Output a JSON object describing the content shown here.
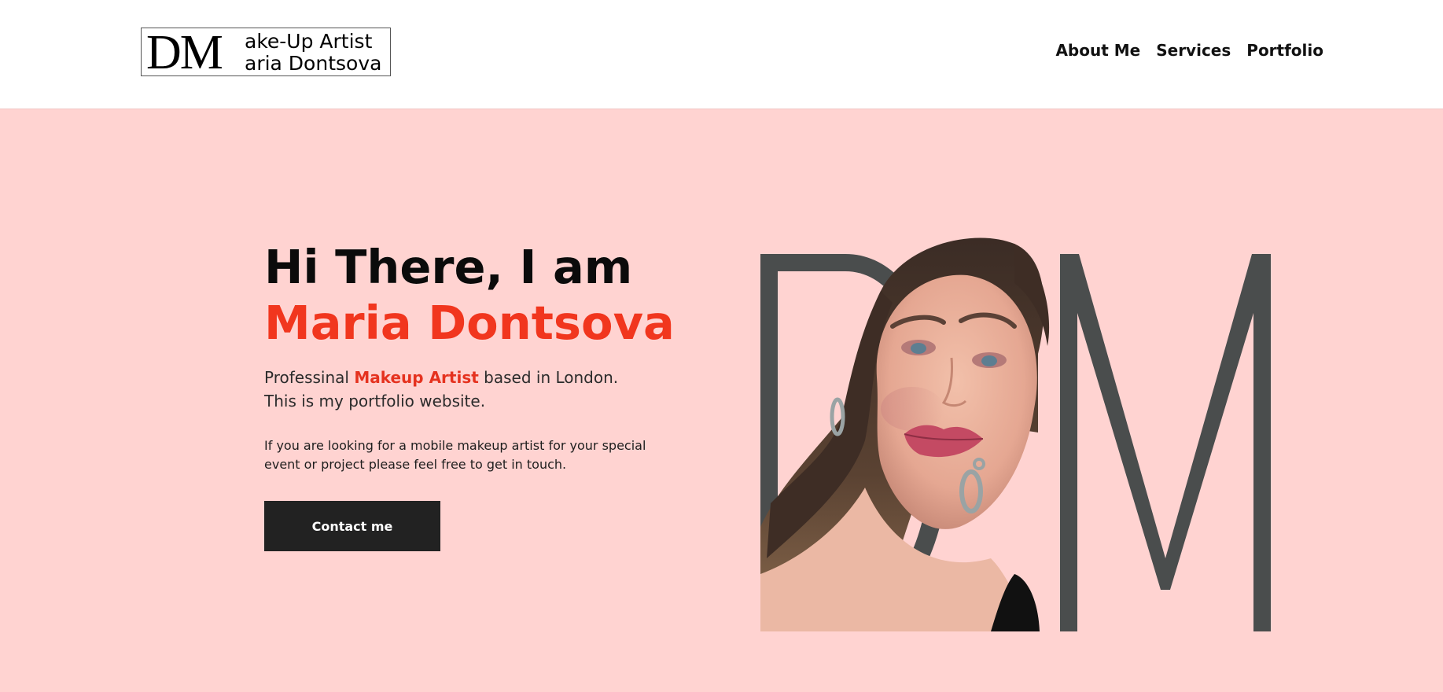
{
  "header": {
    "logo": {
      "monogram": "DM",
      "line1": "ake-Up Artist",
      "line2": "aria Dontsova"
    },
    "nav": [
      {
        "label": "About Me"
      },
      {
        "label": "Services"
      },
      {
        "label": "Portfolio"
      }
    ]
  },
  "hero": {
    "greeting": "Hi There, I am",
    "name": "Maria Dontsova",
    "intro_before": "Professinal ",
    "intro_accent": "Makeup Artist",
    "intro_after": " based in London. This is my portfolio website.",
    "description": "If you are looking for a mobile makeup artist for your special event or project please feel free to get in touch.",
    "contact_button": "Contact me",
    "graphic_monogram": "DM"
  },
  "colors": {
    "background": "#ffd3d1",
    "accent": "#f1361e",
    "button": "#222222",
    "monogram": "#4a4d4d"
  },
  "icons": [
    "portrait-photo"
  ]
}
